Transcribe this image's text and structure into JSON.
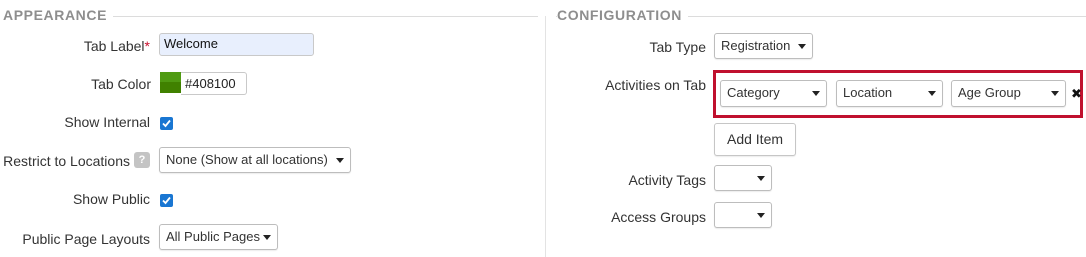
{
  "appearance": {
    "title": "APPEARANCE",
    "tab_label": {
      "label": "Tab Label",
      "required_mark": "*",
      "value": "Welcome"
    },
    "tab_color": {
      "label": "Tab Color",
      "value": "#408100",
      "swatch_color": "#408100"
    },
    "show_internal": {
      "label": "Show Internal",
      "checked": true
    },
    "restrict_locations": {
      "label": "Restrict to Locations",
      "help_icon": "?",
      "selected": "None (Show at all locations)"
    },
    "show_public": {
      "label": "Show Public",
      "checked": true
    },
    "public_layouts": {
      "label": "Public Page Layouts",
      "selected": "All Public Pages"
    }
  },
  "configuration": {
    "title": "CONFIGURATION",
    "tab_type": {
      "label": "Tab Type",
      "selected": "Registration"
    },
    "activities_on_tab": {
      "label": "Activities on Tab",
      "selects": [
        "Category",
        "Location",
        "Age Group"
      ],
      "remove_icon": "✖"
    },
    "add_item_label": "Add Item",
    "activity_tags": {
      "label": "Activity Tags",
      "selected": ""
    },
    "access_groups": {
      "label": "Access Groups",
      "selected": ""
    }
  },
  "colors": {
    "highlight": "#c0102e",
    "checkbox": "#1976d2",
    "required": "#c8102e"
  }
}
